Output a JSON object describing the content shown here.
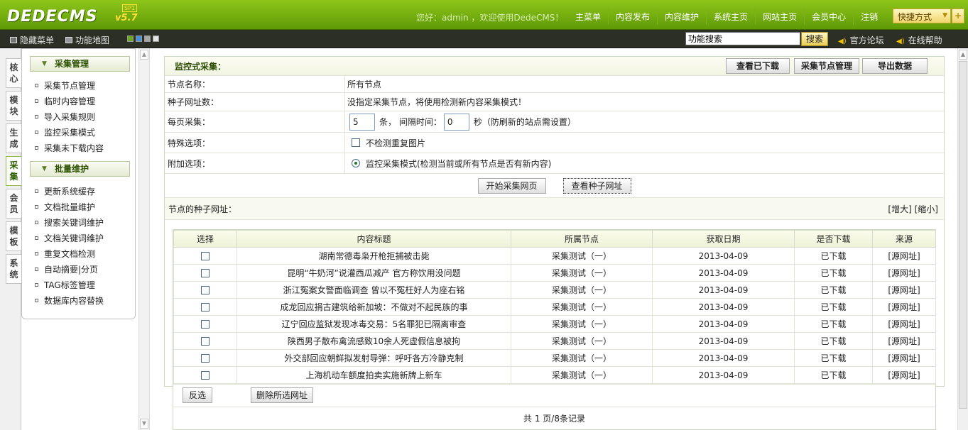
{
  "header": {
    "brand": "DEDECMS",
    "version": "v5.7",
    "sp": "SP1",
    "welcome": "您好：admin ，欢迎使用DedeCMS！",
    "nav": [
      "主菜单",
      "内容发布",
      "内容维护",
      "系统主页",
      "网站主页",
      "会员中心",
      "注销"
    ],
    "quick": "快捷方式",
    "plus": "+"
  },
  "toolbar": {
    "hide_menu": "隐藏菜单",
    "func_map": "功能地图",
    "search_value": "功能搜索",
    "search_btn": "搜索",
    "forum": "官方论坛",
    "help": "在线帮助",
    "swatches": [
      "#6aa823",
      "#4a8fd6",
      "#a7a7a7",
      "#e4e4e4"
    ]
  },
  "vtabs": [
    "核心",
    "模块",
    "生成",
    "采集",
    "会员",
    "模板",
    "系统"
  ],
  "menu": {
    "group1": "采集管理",
    "group1_items": [
      "采集节点管理",
      "临时内容管理",
      "导入采集规则",
      "监控采集模式",
      "采集未下载内容"
    ],
    "group2": "批量维护",
    "group2_items": [
      "更新系统缓存",
      "文档批量维护",
      "搜索关键词维护",
      "文档关键词维护",
      "重复文档检测",
      "自动摘要|分页",
      "TAG标签管理",
      "数据库内容替换"
    ]
  },
  "main": {
    "title": "监控式采集：",
    "btn_downloaded": "查看已下载",
    "btn_nodes": "采集节点管理",
    "btn_export": "导出数据",
    "node_label": "节点名称：",
    "node_value": "所有节点",
    "seed_label": "种子网址数：",
    "seed_value": "没指定采集节点，将使用检测新内容采集模式！",
    "per_label": "每页采集：",
    "per_value": "5",
    "per_unit": "条，  间隔时间：",
    "interval_value": "0",
    "interval_unit": "秒（防刷新的站点需设置）",
    "special_label": "特殊选项：",
    "special_option": "不检测重复图片",
    "extra_label": "附加选项：",
    "extra_option": "监控采集模式(检测当前或所有节点是否有新内容)",
    "btn_start": "开始采集网页",
    "btn_seed": "查看种子网址",
    "seed_urls": "节点的种子网址：",
    "enlarge": "[增大]",
    "shrink": "[缩小]"
  },
  "table": {
    "columns": [
      "选择",
      "内容标题",
      "所属节点",
      "获取日期",
      "是否下载",
      "来源"
    ],
    "rows": [
      {
        "title": "湖南常德毒枭开枪拒捕被击毙",
        "node": "采集测试（一）",
        "date": "2013-04-09",
        "status": "已下载",
        "source": "[源网址]"
      },
      {
        "title": "昆明“牛奶河”说灌西瓜减产 官方称饮用没问题",
        "node": "采集测试（一）",
        "date": "2013-04-09",
        "status": "已下载",
        "source": "[源网址]"
      },
      {
        "title": "浙江冤案女警面临调查 曾以不冤枉好人为座右铭",
        "node": "采集测试（一）",
        "date": "2013-04-09",
        "status": "已下载",
        "source": "[源网址]"
      },
      {
        "title": "成龙回应捐古建筑给新加坡：不做对不起民族的事",
        "node": "采集测试（一）",
        "date": "2013-04-09",
        "status": "已下载",
        "source": "[源网址]"
      },
      {
        "title": "辽宁回应监狱发现冰毒交易：5名罪犯已隔离审查",
        "node": "采集测试（一）",
        "date": "2013-04-09",
        "status": "已下载",
        "source": "[源网址]"
      },
      {
        "title": "陕西男子散布禽流感致10余人死虚假信息被拘",
        "node": "采集测试（一）",
        "date": "2013-04-09",
        "status": "已下载",
        "source": "[源网址]"
      },
      {
        "title": "外交部回应朝鲜拟发射导弹：呼吁各方冷静克制",
        "node": "采集测试（一）",
        "date": "2013-04-09",
        "status": "已下载",
        "source": "[源网址]"
      },
      {
        "title": "上海机动车额度拍卖实施新牌上新车",
        "node": "采集测试（一）",
        "date": "2013-04-09",
        "status": "已下载",
        "source": "[源网址]"
      }
    ],
    "btn_invert": "反选",
    "btn_delete": "删除所选网址",
    "pager": "共 1 页/8条记录"
  }
}
